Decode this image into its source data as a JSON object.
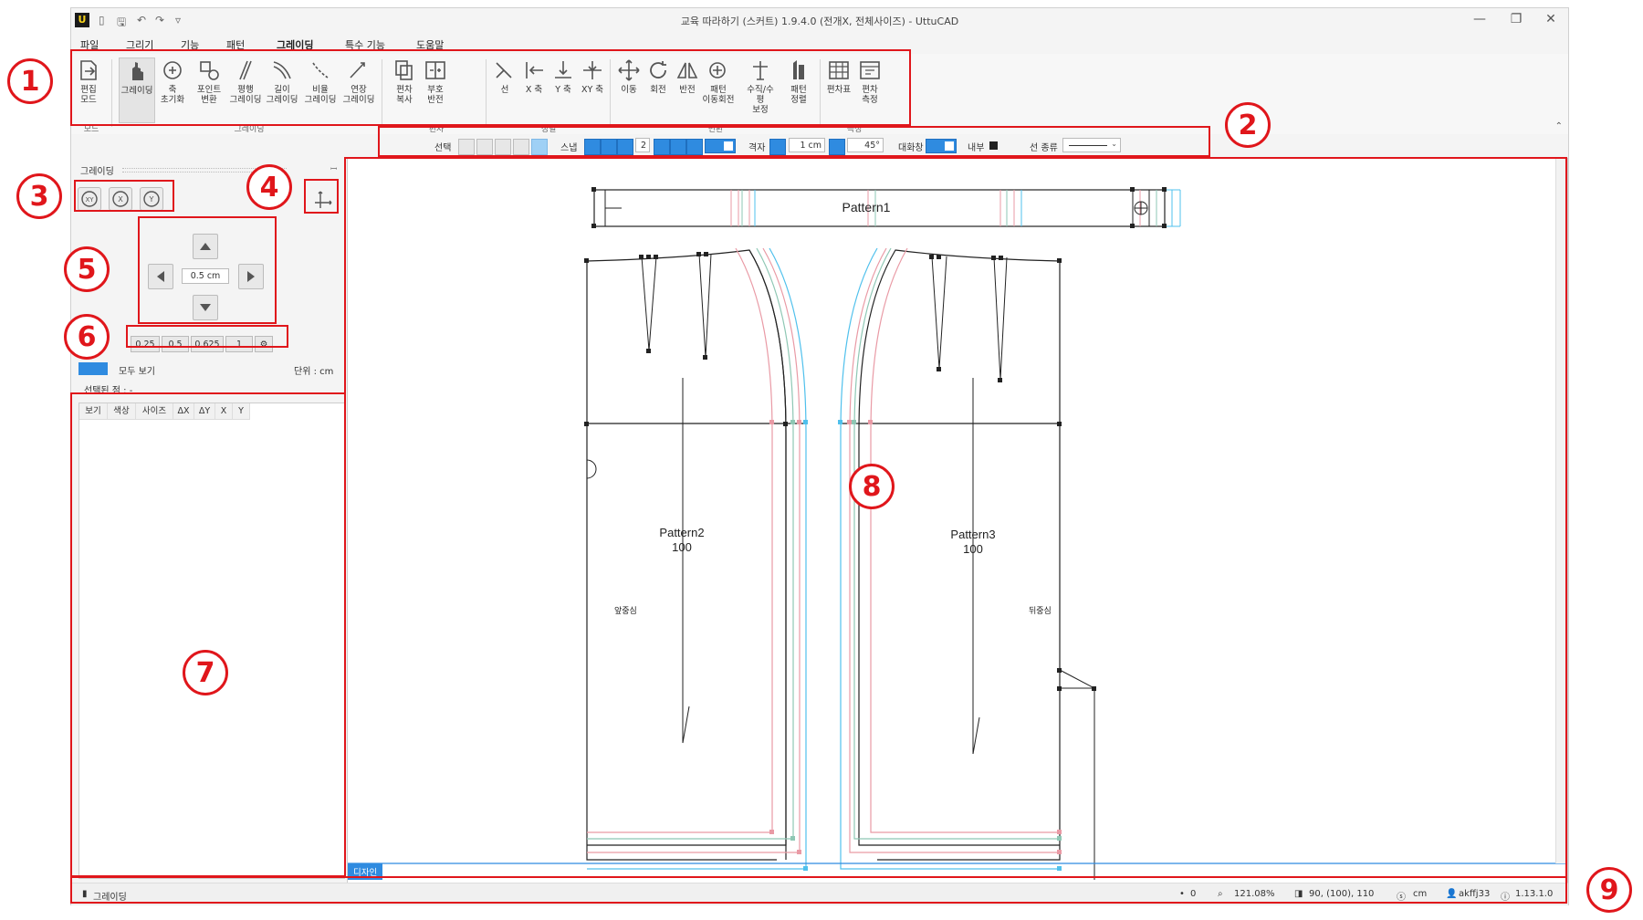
{
  "window": {
    "logo": "U",
    "title": "교육 따라하기 (스커트) 1.9.4.0 (전개X, 전체사이즈) - UttuCAD",
    "minimize": "—",
    "restore": "❐",
    "close": "✕"
  },
  "menus": [
    "파일",
    "그리기",
    "기능",
    "패턴",
    "그레이딩",
    "특수 기능",
    "도움말"
  ],
  "ribbon": {
    "buttons": [
      {
        "l1": "편집",
        "l2": "모드"
      },
      {
        "l1": "그레이딩",
        "l2": ""
      },
      {
        "l1": "축",
        "l2": "초기화"
      },
      {
        "l1": "포인트",
        "l2": "변환"
      },
      {
        "l1": "평행",
        "l2": "그레이딩"
      },
      {
        "l1": "길이",
        "l2": "그레이딩"
      },
      {
        "l1": "비율",
        "l2": "그레이딩"
      },
      {
        "l1": "연장",
        "l2": "그레이딩"
      },
      {
        "l1": "편차",
        "l2": "복사"
      },
      {
        "l1": "부호",
        "l2": "반전"
      },
      {
        "l1": "선",
        "l2": ""
      },
      {
        "l1": "X 축",
        "l2": ""
      },
      {
        "l1": "Y 축",
        "l2": ""
      },
      {
        "l1": "XY 축",
        "l2": ""
      },
      {
        "l1": "이동",
        "l2": ""
      },
      {
        "l1": "회전",
        "l2": ""
      },
      {
        "l1": "반전",
        "l2": ""
      },
      {
        "l1": "패턴",
        "l2": "이동회전"
      },
      {
        "l1": "수직/수평",
        "l2": "보정"
      },
      {
        "l1": "패턴",
        "l2": "정렬"
      },
      {
        "l1": "편차표",
        "l2": ""
      },
      {
        "l1": "편차",
        "l2": "측정"
      }
    ],
    "groups": [
      "모드",
      "그레이딩",
      "편차",
      "정렬",
      "변환",
      "측정"
    ]
  },
  "options": {
    "select_label": "선택",
    "snap_label": "스냅",
    "snap_value": "2",
    "grid_label": "격자",
    "grid_value": "1 cm",
    "angle_value": "45°",
    "dialog_label": "대화창",
    "inner_label": "내부",
    "line_type_label": "선 종류"
  },
  "panel": {
    "title": "그레이딩",
    "pin": "ㅁ",
    "step_value": "0.5 cm",
    "presets": [
      "0.25",
      "0.5",
      "0.625",
      "1"
    ],
    "show_all": "모두 보기",
    "unit": "단위 : cm",
    "selected_point": "선택된 점 : -",
    "table_headers": [
      "보기",
      "색상",
      "사이즈",
      "ΔX",
      "ΔY",
      "X",
      "Y"
    ]
  },
  "canvas": {
    "pattern1": "Pattern1",
    "pattern2": "Pattern2",
    "pattern2_size": "100",
    "pattern3": "Pattern3",
    "pattern3_size": "100",
    "front_label": "앞중심",
    "back_label": "뒤중심",
    "tab": "디자인"
  },
  "status": {
    "mode": "그레이딩",
    "count": "0",
    "zoom": "121.08%",
    "sizes": "90, (100), 110",
    "unit": "cm",
    "user": "akffj33",
    "version": "1.13.1.0"
  },
  "callouts": [
    "1",
    "2",
    "3",
    "4",
    "5",
    "6",
    "7",
    "8",
    "9"
  ]
}
